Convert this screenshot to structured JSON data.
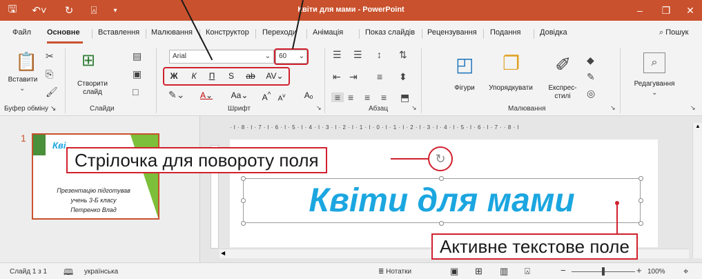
{
  "window": {
    "title": "Квіти для мами  -  PowerPoint",
    "titlebar_color": "#C9512D",
    "qat_icons": [
      "save-icon",
      "undo-icon",
      "redo-icon",
      "present-icon",
      "customize-icon"
    ]
  },
  "tabs": [
    "Файл",
    "Основне",
    "Вставлення",
    "Малювання",
    "Конструктор",
    "Переходи",
    "Анімація",
    "Показ слайдів",
    "Рецензування",
    "Подання",
    "Довідка"
  ],
  "search_label": "Пошук",
  "ribbon": {
    "clipboard": {
      "paste_label": "Вставити",
      "group_label": "Буфер обміну"
    },
    "slides": {
      "new_slide_line1": "Створити",
      "new_slide_line2": "слайд",
      "group_label": "Слайди"
    },
    "font": {
      "font_name": "Arial",
      "font_size": "60",
      "bold": "Ж",
      "italic": "К",
      "underline": "П",
      "shadow": "S",
      "strike": "ab",
      "spacing": "AV",
      "case": "Aa",
      "grow": "A",
      "shrink": "A",
      "clear": "A",
      "group_label": "Шрифт"
    },
    "paragraph": {
      "group_label": "Абзац"
    },
    "drawing": {
      "shapes_label": "Фігури",
      "arrange_label": "Упорядкувати",
      "styles_line1": "Експрес-",
      "styles_line2": "стилі",
      "group_label": "Малювання"
    },
    "editing": {
      "label": "Редагування"
    }
  },
  "thumbnail": {
    "number": "1",
    "title": "Кві",
    "line1": "Презентацію підготував",
    "line2": "учень 3-Б класу",
    "line3": "Петренко Влад"
  },
  "ruler": "· l · 8 · l · 7 · l · 6 · l · 5 · l · 4 · l · 3 · l · 2 · l · 1 · l · 0 · l · 1 · l · 2 · l · 3 · l · 4 · l · 5 · l · 6 · l · 7 ·   · 8 · l",
  "slide": {
    "title": "Квіти для мами",
    "title_color": "#1BA6E0"
  },
  "callouts": {
    "rotate": "Стрілочка для повороту поля",
    "active": "Активне текстове поле",
    "color": "#D0202D"
  },
  "status": {
    "slide_info": "Слайд 1 з 1",
    "language": "українська",
    "notes": "Нотатки",
    "zoom": "100%"
  }
}
